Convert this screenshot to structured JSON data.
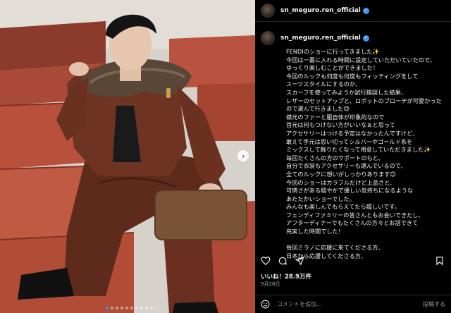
{
  "post": {
    "username": "sn_meguro.ren_official",
    "caption_username": "sn_meguro.ren_official",
    "caption": "FENDIのショーに行ってきました✨\n今回は一番に入れる時間に設定していただいていたので、\nゆっくり楽しむことができました！\n今回のルックも何度も何度もフィッティングをして\nスーツスタイルにするのか、\nスカーフを使ってみようか試行錯誤した結果、\nレザーのセットアップと、ロボットのブローチが可愛かった\nので選んで行きました😊\n襟元のファーと服自体が印象的なので\n首元は何もつけない方がいいなぁと思って\nアクセサリーはつける予定はなかったんですけど、\n敢えて手元は思い切ってシルバーやゴールド系を\nミックスして飾りたくなって用意していただきました✨\n毎回たくさんの方のサポートのもと、\n自分で衣装もアクセサリーも選んでいるので、\n全てのルックに想いがしっかりあります😊\n今回のショーはカラフルだけど上品さと、\n可憐さがある穏やかで優しい気持ちになるような\nあたたかいショーでした。\nみんなも楽しんでもらえてたら嬉しいです。\nフェンディファミリーの皆さんともお会いできたし、\nアフターディナーでもたくさんの方々とお話できて\n充実した時間でした！\n\n毎回ミラノに応援に来てくださる方、\n日本から応援してくださる方、",
    "likes": "いいね！28.9万件",
    "date": "9月28日"
  },
  "comment": {
    "placeholder": "コメントを追加...",
    "post_label": "投稿する"
  },
  "carousel": {
    "total_dots": 10,
    "active_index": 0
  },
  "colors": {
    "background": "#000000",
    "verified_badge": "#3897f0",
    "carousel_active_dot": "#3b8cff",
    "leather": "#6e3322",
    "seat_red": "#b9523f"
  },
  "icons": [
    "heart-icon",
    "comment-icon",
    "share-icon",
    "bookmark-icon",
    "emoji-icon",
    "chevron-right-icon",
    "verified-icon"
  ]
}
